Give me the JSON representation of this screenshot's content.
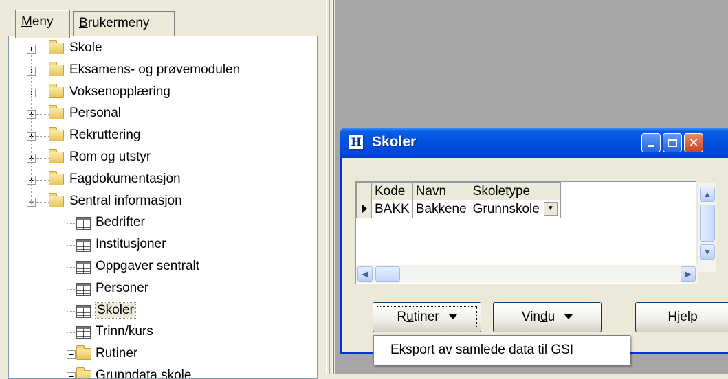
{
  "left_panel": {
    "tabs": [
      {
        "prefix": "",
        "underlined": "M",
        "rest": "eny"
      },
      {
        "prefix": "",
        "underlined": "B",
        "rest": "rukermeny"
      }
    ],
    "tree": [
      {
        "label": "Skole",
        "kind": "folder",
        "state": "collapsed"
      },
      {
        "label": "Eksamens- og prøvemodulen",
        "kind": "folder",
        "state": "collapsed"
      },
      {
        "label": "Voksenopplæring",
        "kind": "folder",
        "state": "collapsed"
      },
      {
        "label": "Personal",
        "kind": "folder",
        "state": "collapsed"
      },
      {
        "label": "Rekruttering",
        "kind": "folder",
        "state": "collapsed"
      },
      {
        "label": "Rom og utstyr",
        "kind": "folder",
        "state": "collapsed"
      },
      {
        "label": "Fagdokumentasjon",
        "kind": "folder",
        "state": "collapsed"
      },
      {
        "label": "Sentral informasjon",
        "kind": "folder",
        "state": "expanded"
      },
      {
        "label": "Bedrifter",
        "kind": "table"
      },
      {
        "label": "Institusjoner",
        "kind": "table"
      },
      {
        "label": "Oppgaver sentralt",
        "kind": "table"
      },
      {
        "label": "Personer",
        "kind": "table"
      },
      {
        "label": "Skoler",
        "kind": "table",
        "selected": true
      },
      {
        "label": "Trinn/kurs",
        "kind": "table"
      },
      {
        "label": "Rutiner",
        "kind": "subfolder",
        "state": "collapsed"
      },
      {
        "label": "Grunndata skole",
        "kind": "subfolder",
        "state": "collapsed"
      }
    ]
  },
  "window": {
    "title": "Skoler",
    "icon_letter": "H",
    "grid": {
      "columns": [
        "Kode",
        "Navn",
        "Skoletype"
      ],
      "rows": [
        {
          "kode": "BAKK",
          "navn": "Bakkene",
          "skoletype": "Grunnskole"
        }
      ]
    },
    "buttons": {
      "rutiner": {
        "before": "R",
        "underlined": "u",
        "after": "tiner"
      },
      "vindu": {
        "before": "Vin",
        "underlined": "d",
        "after": "u"
      },
      "hjelp": {
        "before": "H",
        "underlined": "j",
        "after": "elp"
      }
    },
    "dropdown": {
      "items": [
        "Eksport av samlede data til GSI"
      ]
    }
  },
  "colors": {
    "titlebar": "#0050e0",
    "close_button": "#c74523",
    "face": "#ece9d8",
    "mdi_background": "#a6a6a6"
  }
}
